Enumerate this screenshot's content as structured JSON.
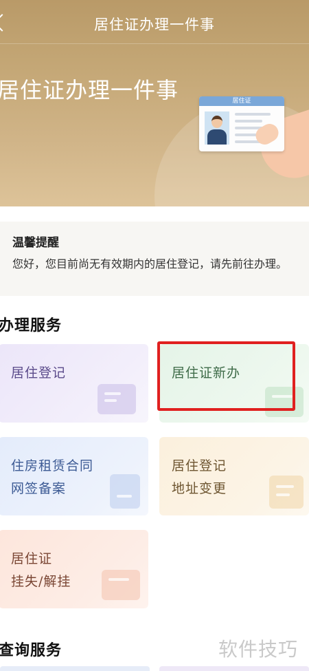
{
  "nav": {
    "back_icon": "chevron-left-icon",
    "title": "居住证办理一件事"
  },
  "banner": {
    "title": "居住证办理一件事",
    "card_label": "居住证"
  },
  "reminder": {
    "title": "温馨提醒",
    "text": "您好，您目前尚无有效期内的居住登记，请先前往办理。"
  },
  "services": {
    "section_title": "办理服务",
    "tiles": [
      {
        "line1": "居住登记",
        "line2": "",
        "icon": "document-user-icon",
        "color": "#ece6f9"
      },
      {
        "line1": "居住证新办",
        "line2": "",
        "icon": "id-card-icon",
        "color": "#e5f4e8",
        "highlighted": true
      },
      {
        "line1": "住房租赁合同",
        "line2": "网签备案",
        "icon": "contract-star-icon",
        "color": "#e4ecfb"
      },
      {
        "line1": "居住登记",
        "line2": "地址变更",
        "icon": "address-change-icon",
        "color": "#fbf0dd"
      },
      {
        "line1": "居住证",
        "line2": "挂失/解挂",
        "icon": "card-block-icon",
        "color": "#fde6dc"
      }
    ]
  },
  "query": {
    "section_title": "查询服务"
  },
  "watermark": "软件技巧",
  "colors": {
    "banner": "#c5a877",
    "highlight_border": "#e0201f"
  }
}
